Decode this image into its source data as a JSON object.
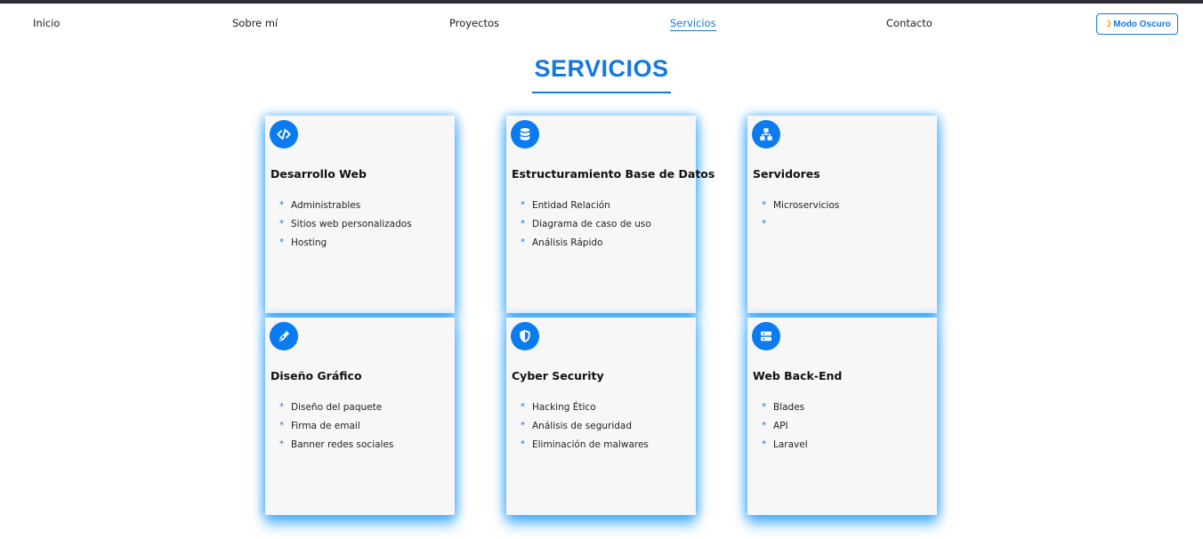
{
  "nav": {
    "items": [
      {
        "label": "Inicio"
      },
      {
        "label": "Sobre mí"
      },
      {
        "label": "Proyectos"
      },
      {
        "label": "Servicios",
        "active": true
      },
      {
        "label": "Contacto"
      }
    ],
    "dark_mode_label": "Modo Oscuro",
    "dark_mode_icon": "moon-icon"
  },
  "section": {
    "title": "SERVICIOS"
  },
  "colors": {
    "accent": "#1478e0",
    "icon_bg": "#0b7cf0",
    "card_bg": "#f7f7f7",
    "glow": "#28a0ff"
  },
  "cards": [
    {
      "title": "Desarrollo Web",
      "icon": "code-icon",
      "items": [
        "Administrables",
        "Sitios web personalizados",
        "Hosting"
      ]
    },
    {
      "title": "Estructuramiento Base de Datos",
      "icon": "database-icon",
      "items": [
        "Entidad Relación",
        "Diagrama de caso de uso",
        "Análisis Rápido"
      ]
    },
    {
      "title": "Servidores",
      "icon": "network-icon",
      "items": [
        "Microservicios",
        ""
      ]
    },
    {
      "title": "Diseño Gráfico",
      "icon": "pen-nib-icon",
      "items": [
        "Diseño del paquete",
        "Firma de email",
        "Banner redes sociales"
      ]
    },
    {
      "title": "Cyber Security",
      "icon": "shield-icon",
      "items": [
        "Hacking Ético",
        "Análisis de seguridad",
        "Eliminación de malwares"
      ]
    },
    {
      "title": "Web Back-End",
      "icon": "server-icon",
      "items": [
        "Blades",
        "API",
        "Laravel"
      ]
    }
  ]
}
